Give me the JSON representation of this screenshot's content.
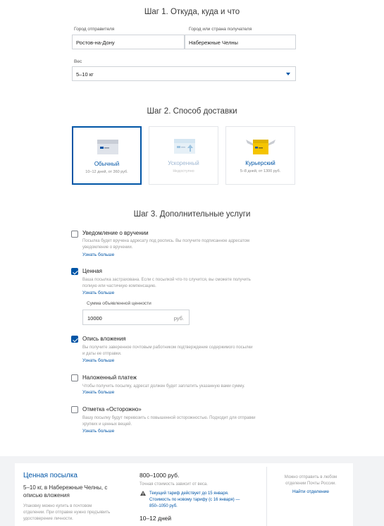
{
  "step1": {
    "title": "Шаг 1. Откуда, куда и что",
    "from_label": "Город отправителя",
    "from_value": "Ростов-на-Дону",
    "to_label": "Город или страна получателя",
    "to_value": "Набережные Челны",
    "weight_label": "Вес",
    "weight_value": "5–10 кг"
  },
  "step2": {
    "title": "Шаг 2. Способ доставки",
    "options": [
      {
        "name": "Обычный",
        "sub": "10–12 дней, от 360 руб.",
        "selected": true
      },
      {
        "name": "Ускоренный",
        "sub": "Недоступно",
        "disabled": true
      },
      {
        "name": "Курьерский",
        "sub": "5–8 дней, от 1300 руб."
      }
    ]
  },
  "step3": {
    "title": "Шаг 3. Дополнительные услуги",
    "services": [
      {
        "title": "Уведомление о вручении",
        "desc1": "Посылка будет вручена адресату под роспись. Вы получите подписанное адресатом",
        "desc2": "уведомление о вручении.",
        "link": "Узнать больше",
        "checked": false
      },
      {
        "title": "Ценная",
        "desc1": "Ваша посылка застрахована. Если с посылкой что-то случится, вы сможете получить",
        "desc2": "полную или частичную компенсацию.",
        "link": "Узнать больше",
        "checked": true
      },
      {
        "title": "Опись вложения",
        "desc1": "Вы получите заверенное почтовым работником подтверждение содержимого посылки",
        "desc2": "и даты ее отправки.",
        "link": "Узнать больше",
        "checked": true
      },
      {
        "title": "Наложенный платеж",
        "desc1": "Чтобы получить посылку, адресат должен будет заплатить указанную вами сумму.",
        "desc2": "",
        "link": "Узнать больше",
        "checked": false
      },
      {
        "title": "Отметка «Осторожно»",
        "desc1": "Вашу посылку будут перевозить с повышенной осторожностью. Подходит для отправки",
        "desc2": "хрупких и ценных вещей.",
        "link": "Узнать больше",
        "checked": false
      }
    ],
    "declared_label": "Сумма объявленной ценности",
    "declared_value": "10000",
    "declared_unit": "руб."
  },
  "summary": {
    "title": "Ценная посылка",
    "subtitle1": "5–10 кг, в Набережные Челны, с",
    "subtitle2": "описью вложения",
    "note1": "Упаковку можно купить в почтовом",
    "note2": "отделении. При отправке нужно предъявить",
    "note3": "удостоверение личности.",
    "price": "800–1000 руб.",
    "price_note": "Точная стоимость зависит от веса.",
    "tariff1": "Текущий тариф действует до 15 января.",
    "tariff2": "Стоимость по новому тарифу (с 16 января) —",
    "tariff3": "850–1050 руб.",
    "days": "10–12 дней",
    "right1": "Можно отправить в любом",
    "right2": "отделении Почты России.",
    "find_link": "Найти отделение"
  },
  "colors": {
    "accent": "#0055a6",
    "courier_yellow": "#f5c400"
  }
}
